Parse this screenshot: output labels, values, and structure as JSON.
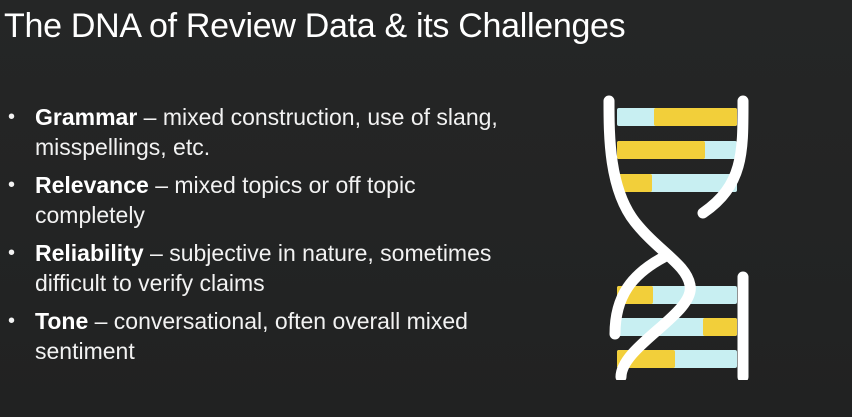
{
  "slide": {
    "title": "The DNA of Review Data & its Challenges",
    "bullets": [
      {
        "term": "Grammar",
        "text": " – mixed construction, use of slang, misspellings, etc."
      },
      {
        "term": "Relevance",
        "text": " – mixed topics or off topic completely"
      },
      {
        "term": "Reliability",
        "text": " – subjective in nature, sometimes difficult to verify claims"
      },
      {
        "term": "Tone",
        "text": " – conversational, often overall mixed sentiment"
      }
    ]
  },
  "colors": {
    "background": "#232424",
    "text": "#f4f4f4",
    "dna_strand": "#ffffff",
    "base_yellow": "#f2cf3a",
    "base_blue": "#c8eff2"
  },
  "icons": {
    "dna": "dna-helix-icon",
    "bullet": "bullet-dot"
  }
}
